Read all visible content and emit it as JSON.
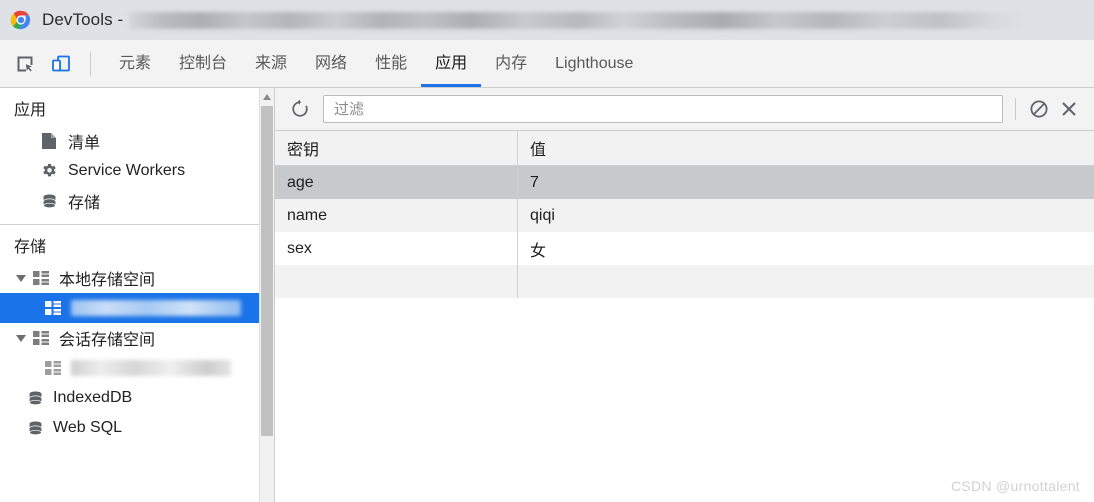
{
  "window": {
    "title_prefix": "DevTools -",
    "title_redacted": true,
    "logo": "chrome-logo"
  },
  "tabstrip": {
    "icons": [
      {
        "name": "inspect-element-icon",
        "label": "检查元素"
      },
      {
        "name": "device-toolbar-icon",
        "label": "设备工具栏"
      }
    ],
    "tabs": [
      {
        "label": "元素",
        "active": false
      },
      {
        "label": "控制台",
        "active": false
      },
      {
        "label": "来源",
        "active": false
      },
      {
        "label": "网络",
        "active": false
      },
      {
        "label": "性能",
        "active": false
      },
      {
        "label": "应用",
        "active": true
      },
      {
        "label": "内存",
        "active": false
      },
      {
        "label": "Lighthouse",
        "active": false
      }
    ],
    "active_underline_color": "#1a73e8"
  },
  "sidebar": {
    "application": {
      "title": "应用",
      "items": [
        {
          "label": "清单",
          "icon": "document-icon"
        },
        {
          "label": "Service Workers",
          "icon": "gear-icon"
        },
        {
          "label": "存储",
          "icon": "database-icon"
        }
      ]
    },
    "storage": {
      "title": "存储",
      "tree": [
        {
          "label": "本地存储空间",
          "icon": "grid-icon",
          "expanded": true,
          "level": 0,
          "redacted": false
        },
        {
          "label": "",
          "icon": "grid-icon",
          "level": 1,
          "redacted": true,
          "selected": true
        },
        {
          "label": "会话存储空间",
          "icon": "grid-icon",
          "expanded": true,
          "level": 0,
          "redacted": false
        },
        {
          "label": "",
          "icon": "grid-icon",
          "level": 1,
          "redacted": true,
          "selected": false
        },
        {
          "label": "IndexedDB",
          "icon": "database-icon",
          "level": 0,
          "redacted": false
        },
        {
          "label": "Web SQL",
          "icon": "database-icon",
          "level": 0,
          "redacted": false
        }
      ],
      "selected_color": "#1a73e8"
    },
    "scrollbar": {
      "name": "sidebar-scrollbar",
      "arrow": "up"
    }
  },
  "panel": {
    "toolbar": {
      "refresh": {
        "name": "refresh-icon",
        "label": "刷新"
      },
      "filter": {
        "placeholder": "过滤",
        "value": ""
      },
      "clear_all": {
        "name": "clear-all-icon",
        "label": "清除所有"
      },
      "delete": {
        "name": "close-icon",
        "label": "删除所选"
      }
    },
    "table": {
      "columns": [
        "密钥",
        "值"
      ],
      "rows": [
        {
          "key": "age",
          "value": "7",
          "selected": true
        },
        {
          "key": "name",
          "value": "qiqi",
          "selected": false
        },
        {
          "key": "sex",
          "value": "女",
          "selected": false
        },
        {
          "key": "",
          "value": "",
          "selected": false
        }
      ]
    }
  },
  "watermark": "CSDN @urnottalent"
}
